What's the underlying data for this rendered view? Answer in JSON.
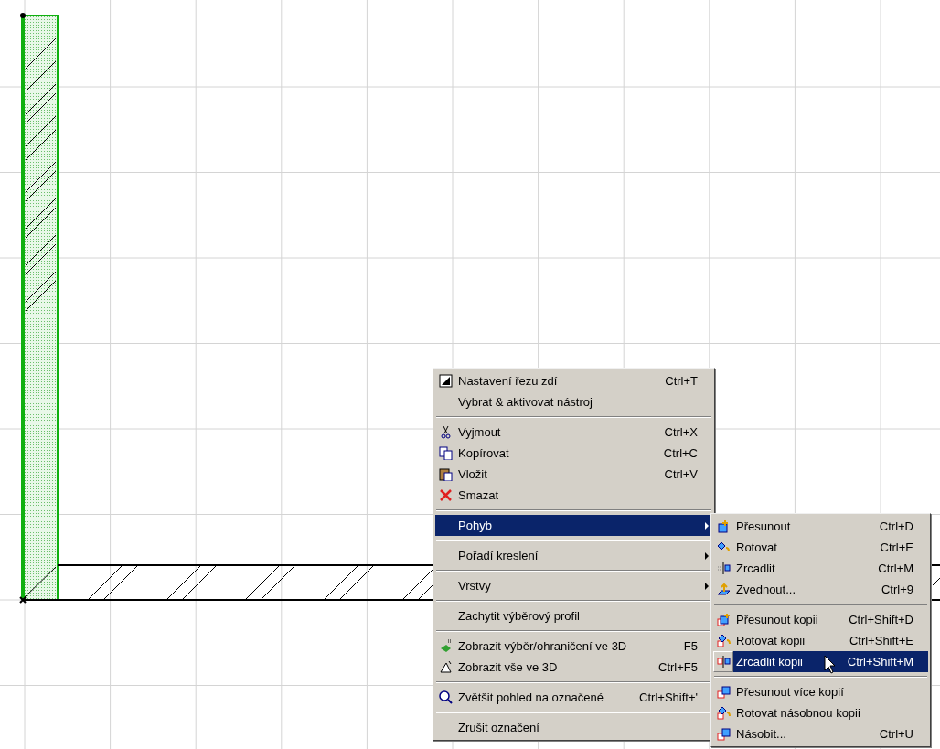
{
  "context_menu": {
    "items": [
      {
        "kind": "item",
        "label": "Nastavení řezu zdí",
        "shortcut": "Ctrl+T",
        "selected": false
      },
      {
        "kind": "item",
        "label": "Vybrat & aktivovat nástroj",
        "selected": false
      },
      {
        "kind": "separator"
      },
      {
        "kind": "item",
        "label": "Vyjmout",
        "shortcut": "Ctrl+X",
        "selected": false
      },
      {
        "kind": "item",
        "label": "Kopírovat",
        "shortcut": "Ctrl+C",
        "selected": false
      },
      {
        "kind": "item",
        "label": "Vložit",
        "shortcut": "Ctrl+V",
        "selected": false
      },
      {
        "kind": "item",
        "label": "Smazat",
        "selected": false
      },
      {
        "kind": "separator"
      },
      {
        "kind": "submenu",
        "label": "Pohyb",
        "selected": true
      },
      {
        "kind": "separator"
      },
      {
        "kind": "submenu",
        "label": "Pořadí kreslení",
        "selected": false
      },
      {
        "kind": "separator"
      },
      {
        "kind": "submenu",
        "label": "Vrstvy",
        "selected": false
      },
      {
        "kind": "separator"
      },
      {
        "kind": "item",
        "label": "Zachytit výběrový profil",
        "selected": false
      },
      {
        "kind": "separator"
      },
      {
        "kind": "item",
        "label": "Zobrazit výběr/ohraničení ve 3D",
        "shortcut": "F5",
        "selected": false
      },
      {
        "kind": "item",
        "label": "Zobrazit vše ve 3D",
        "shortcut": "Ctrl+F5",
        "selected": false
      },
      {
        "kind": "separator"
      },
      {
        "kind": "item",
        "label": "Zvětšit pohled na označené",
        "shortcut": "Ctrl+Shift+'",
        "selected": false
      },
      {
        "kind": "separator"
      },
      {
        "kind": "item",
        "label": "Zrušit označení",
        "selected": false
      }
    ]
  },
  "submenu": {
    "items": [
      {
        "kind": "item",
        "label": "Přesunout",
        "shortcut": "Ctrl+D",
        "selected": false
      },
      {
        "kind": "item",
        "label": "Rotovat",
        "shortcut": "Ctrl+E",
        "selected": false
      },
      {
        "kind": "item",
        "label": "Zrcadlit",
        "shortcut": "Ctrl+M",
        "selected": false
      },
      {
        "kind": "item",
        "label": "Zvednout...",
        "shortcut": "Ctrl+9",
        "selected": false
      },
      {
        "kind": "separator"
      },
      {
        "kind": "item",
        "label": "Přesunout kopii",
        "shortcut": "Ctrl+Shift+D",
        "selected": false
      },
      {
        "kind": "item",
        "label": "Rotovat kopii",
        "shortcut": "Ctrl+Shift+E",
        "selected": false
      },
      {
        "kind": "item",
        "label": "Zrcadlit kopii",
        "shortcut": "Ctrl+Shift+M",
        "selected": true
      },
      {
        "kind": "separator"
      },
      {
        "kind": "item",
        "label": "Přesunout více kopií",
        "selected": false
      },
      {
        "kind": "item",
        "label": "Rotovat násobnou kopii",
        "selected": false
      },
      {
        "kind": "item",
        "label": "Násobit...",
        "shortcut": "Ctrl+U",
        "selected": false
      }
    ]
  }
}
